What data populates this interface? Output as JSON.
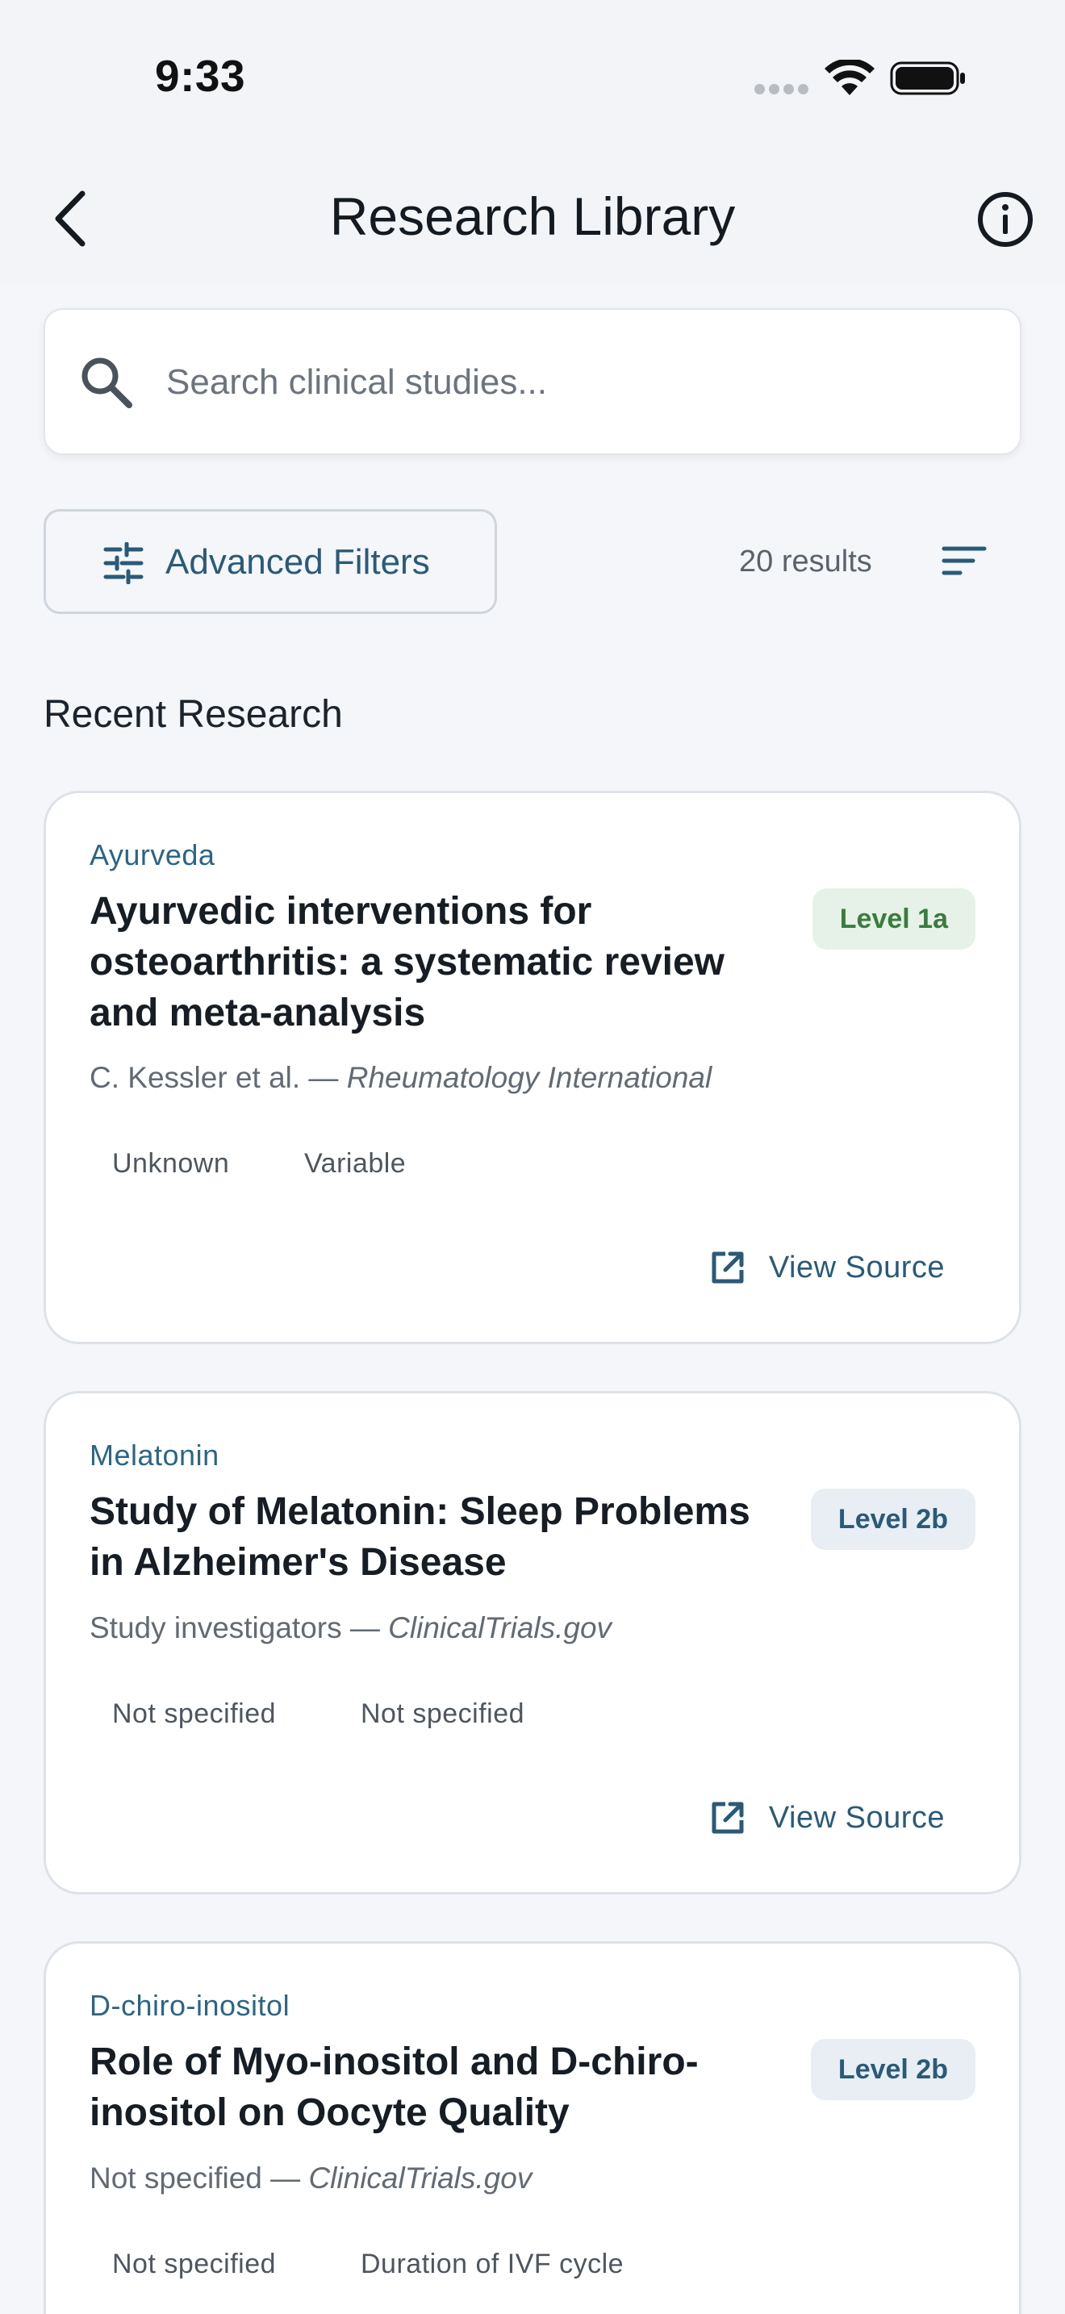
{
  "status_bar": {
    "time": "9:33"
  },
  "header": {
    "title": "Research Library"
  },
  "search": {
    "placeholder": "Search clinical studies..."
  },
  "filters": {
    "advanced_label": "Advanced Filters",
    "results_count": "20 results"
  },
  "section": {
    "title": "Recent Research"
  },
  "cards": [
    {
      "category": "Ayurveda",
      "title_lines": [
        "Ayurvedic interventions for",
        "osteoarthritis: a systematic review",
        "and meta-analysis"
      ],
      "level": "Level 1a",
      "authors": "C. Kessler et al. — ",
      "source": "Rheumatology International",
      "tags": [
        "Unknown",
        "Variable"
      ],
      "action": "View Source"
    },
    {
      "category": "Melatonin",
      "title_lines": [
        "Study of Melatonin: Sleep Problems",
        "in Alzheimer's Disease"
      ],
      "level": "Level 2b",
      "authors": "Study investigators — ",
      "source": "ClinicalTrials.gov",
      "tags": [
        "Not specified",
        "Not specified"
      ],
      "action": "View Source"
    },
    {
      "category": "D-chiro-inositol",
      "title_lines": [
        "Role of Myo-inositol and D-chiro-",
        "inositol on Oocyte Quality"
      ],
      "level": "Level 2b",
      "authors": "Not specified — ",
      "source": "ClinicalTrials.gov",
      "tags": [
        "Not specified",
        "Duration of IVF cycle"
      ]
    }
  ],
  "colors": {
    "accent": "#2a5a78",
    "level_green_bg": "#e6f2e7",
    "level_green_text": "#3a7c3e",
    "level_blue_bg": "#e8eef3",
    "background": "#f4f6f9"
  },
  "icons": {
    "back": "chevron-left-icon",
    "info": "info-circle-icon",
    "search": "search-icon",
    "filters": "tune-sliders-icon",
    "sort": "sort-lines-icon",
    "external": "open-external-icon"
  }
}
